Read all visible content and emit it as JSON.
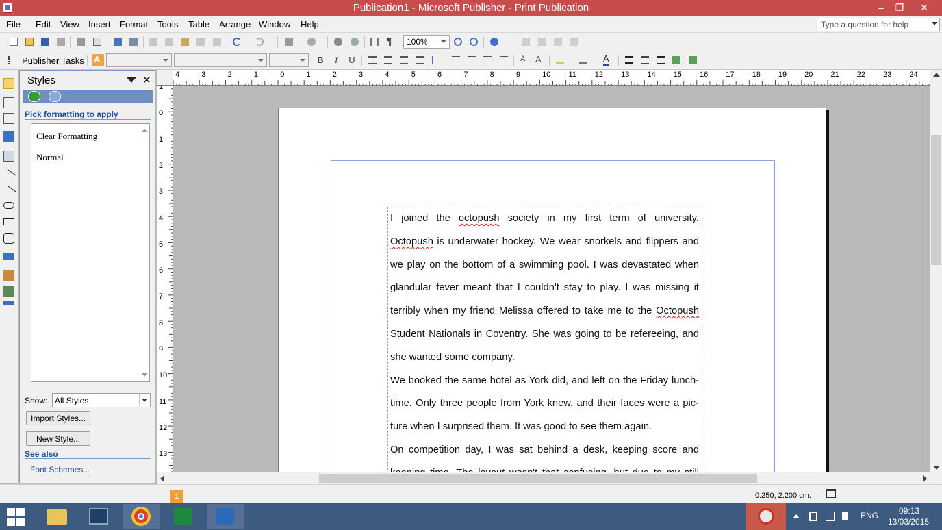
{
  "window": {
    "title": "Publication1 - Microsoft Publisher - Print Publication",
    "minimize": "–",
    "maximize": "❐",
    "close": "✕"
  },
  "menu": {
    "items": [
      "File",
      "Edit",
      "View",
      "Insert",
      "Format",
      "Tools",
      "Table",
      "Arrange",
      "Window",
      "Help"
    ],
    "help_placeholder": "Type a question for help"
  },
  "toolbar": {
    "zoom": "100%",
    "publisher_tasks": "Publisher Tasks",
    "style_box": "",
    "font_box": "",
    "size_box": "",
    "bold": "B",
    "italic": "I",
    "underline": "U"
  },
  "styles_pane": {
    "title": "Styles",
    "subtitle": "Pick formatting to apply",
    "styles": [
      "Clear Formatting",
      "Normal"
    ],
    "show_label": "Show:",
    "show_value": "All Styles",
    "import_button": "Import Styles...",
    "new_button": "New Style...",
    "see_also": "See also",
    "font_schemes": "Font Schemes..."
  },
  "rulers": {
    "horizontal": [
      "4",
      "3",
      "2",
      "1",
      "0",
      "1",
      "2",
      "3",
      "4",
      "5",
      "6",
      "7",
      "8",
      "9",
      "10",
      "11",
      "12",
      "13",
      "14",
      "15",
      "16",
      "17",
      "18",
      "19",
      "20",
      "21",
      "22",
      "23",
      "24"
    ],
    "vertical": [
      "1",
      "0",
      "1",
      "2",
      "3",
      "4",
      "5",
      "6",
      "7",
      "8",
      "9",
      "10",
      "11",
      "12",
      "13"
    ]
  },
  "document": {
    "paragraphs": [
      {
        "lines": [
          [
            {
              "t": "I joined the "
            },
            {
              "t": "octopush",
              "sq": true
            },
            {
              "t": " society in my first term of university."
            }
          ],
          [
            {
              "t": "Octopush",
              "sq": true
            },
            {
              "t": " is underwater hockey. We wear snorkels and flippers and"
            }
          ],
          [
            {
              "t": "we play on the bottom of a swimming pool. I was devastated when"
            }
          ],
          [
            {
              "t": "glandular fever meant that I couldn't stay to play. I was missing it"
            }
          ],
          [
            {
              "t": "terribly when my friend Melissa offered to take me to the "
            },
            {
              "t": "Octopush",
              "sq": true
            }
          ],
          [
            {
              "t": "Student Nationals in Coventry. She was going to be refereeing, and"
            }
          ],
          [
            {
              "t": "she wanted some company."
            }
          ]
        ]
      },
      {
        "lines": [
          [
            {
              "t": "We booked the same hotel as York did, and left on the Friday lunch-"
            }
          ],
          [
            {
              "t": "time. Only three people from York knew, and their faces were a pic-"
            }
          ],
          [
            {
              "t": "ture when I surprised them. It was good to see them again."
            }
          ]
        ]
      },
      {
        "lines": [
          [
            {
              "t": "On competition day, I was sat behind a desk, keeping score and"
            }
          ],
          [
            {
              "t": "keeping time. The layout wasn't that confusing, but due to my still"
            }
          ]
        ]
      }
    ]
  },
  "status": {
    "page_number": "1",
    "coordinates": "0.250, 2.200 cm."
  },
  "taskbar": {
    "language": "ENG",
    "time": "09:13",
    "date": "13/03/2015"
  }
}
